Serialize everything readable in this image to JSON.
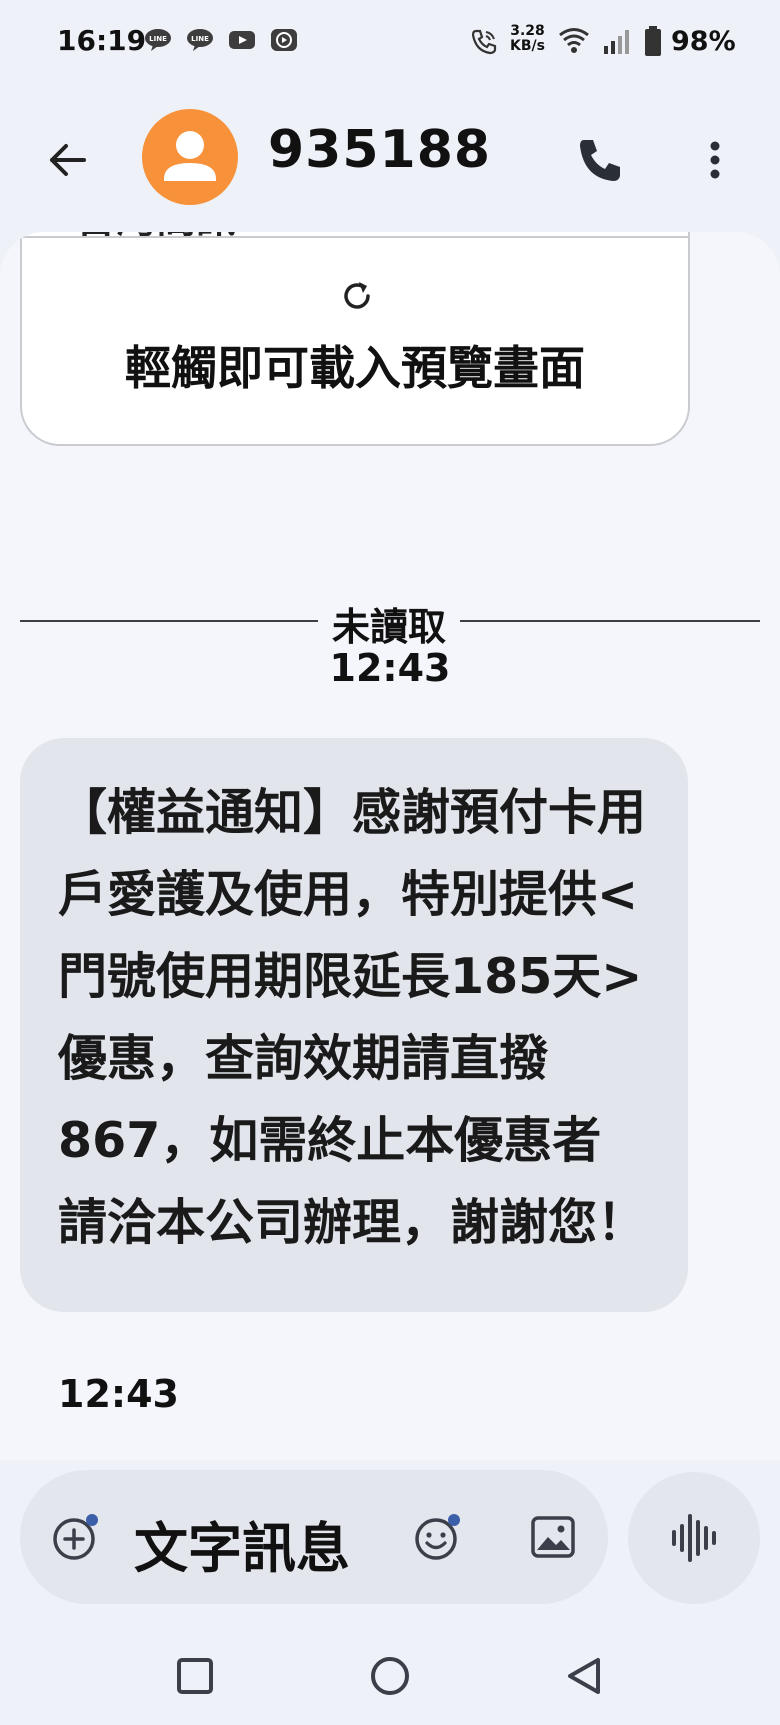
{
  "status_bar": {
    "time": "16:19",
    "notifications": [
      "line-icon",
      "line-icon",
      "youtube-icon",
      "video-app-icon"
    ],
    "net_speed_value": "3.28",
    "net_speed_unit": "KB/s",
    "battery_percent": "98%"
  },
  "header": {
    "title": "935188",
    "back_icon": "arrow-left-icon",
    "call_icon": "phone-icon",
    "more_icon": "more-vertical-icon",
    "avatar_color": "#f7923a"
  },
  "preview_card": {
    "label": "輕觸即可載入預覽畫面",
    "cut_text": "‧台灣簡訊",
    "icon": "refresh-icon"
  },
  "divider": {
    "label": "未讀取"
  },
  "message_timestamp": "12:43",
  "message": {
    "text": "【權益通知】感謝預付卡用戶愛護及使用，特別提供<門號使用期限延長185天>優惠，查詢效期請直撥867，如需終止本優惠者請洽本公司辦理，謝謝您！",
    "time": "12:43"
  },
  "compose": {
    "placeholder": "文字訊息",
    "plus_icon": "add-circle-icon",
    "emoji_icon": "emoji-icon",
    "image_icon": "image-icon",
    "voice_icon": "voice-waveform-icon"
  },
  "colors": {
    "background": "#eef1f7",
    "bubble": "#e2e5ec",
    "accent_dot": "#3b5fa8"
  }
}
